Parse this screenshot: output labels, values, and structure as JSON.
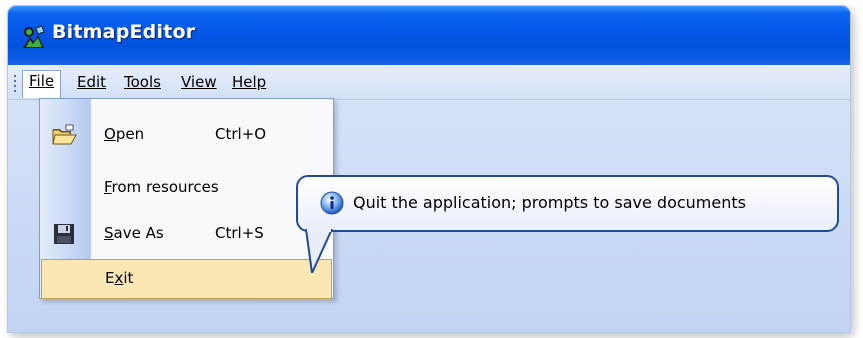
{
  "window": {
    "title": "BitmapEditor",
    "icon": "app-icon"
  },
  "menubar": {
    "items": [
      {
        "label": "File",
        "mnemonic_index": 0,
        "open": true
      },
      {
        "label": "Edit",
        "mnemonic_index": 0
      },
      {
        "label": "Tools",
        "mnemonic_index": 0
      },
      {
        "label": "View",
        "mnemonic_index": 0
      },
      {
        "label": "Help",
        "mnemonic_index": 0
      }
    ]
  },
  "file_menu": {
    "items": [
      {
        "label": "Open",
        "shortcut": "Ctrl+O",
        "icon": "open-folder-icon",
        "mnemonic": "O"
      },
      {
        "label": "From resources",
        "mnemonic": "F"
      },
      {
        "label": "Save As",
        "shortcut": "Ctrl+S",
        "icon": "floppy-disk-icon",
        "mnemonic": "S"
      },
      {
        "label": "Exit",
        "mnemonic": "x",
        "highlighted": true
      }
    ]
  },
  "tooltip": {
    "icon": "info-icon",
    "text": "Quit the application; prompts to save documents"
  },
  "colors": {
    "titlebar": "#0556e8",
    "menu_highlight": "#fbe7b3",
    "tooltip_border": "#234a93"
  }
}
